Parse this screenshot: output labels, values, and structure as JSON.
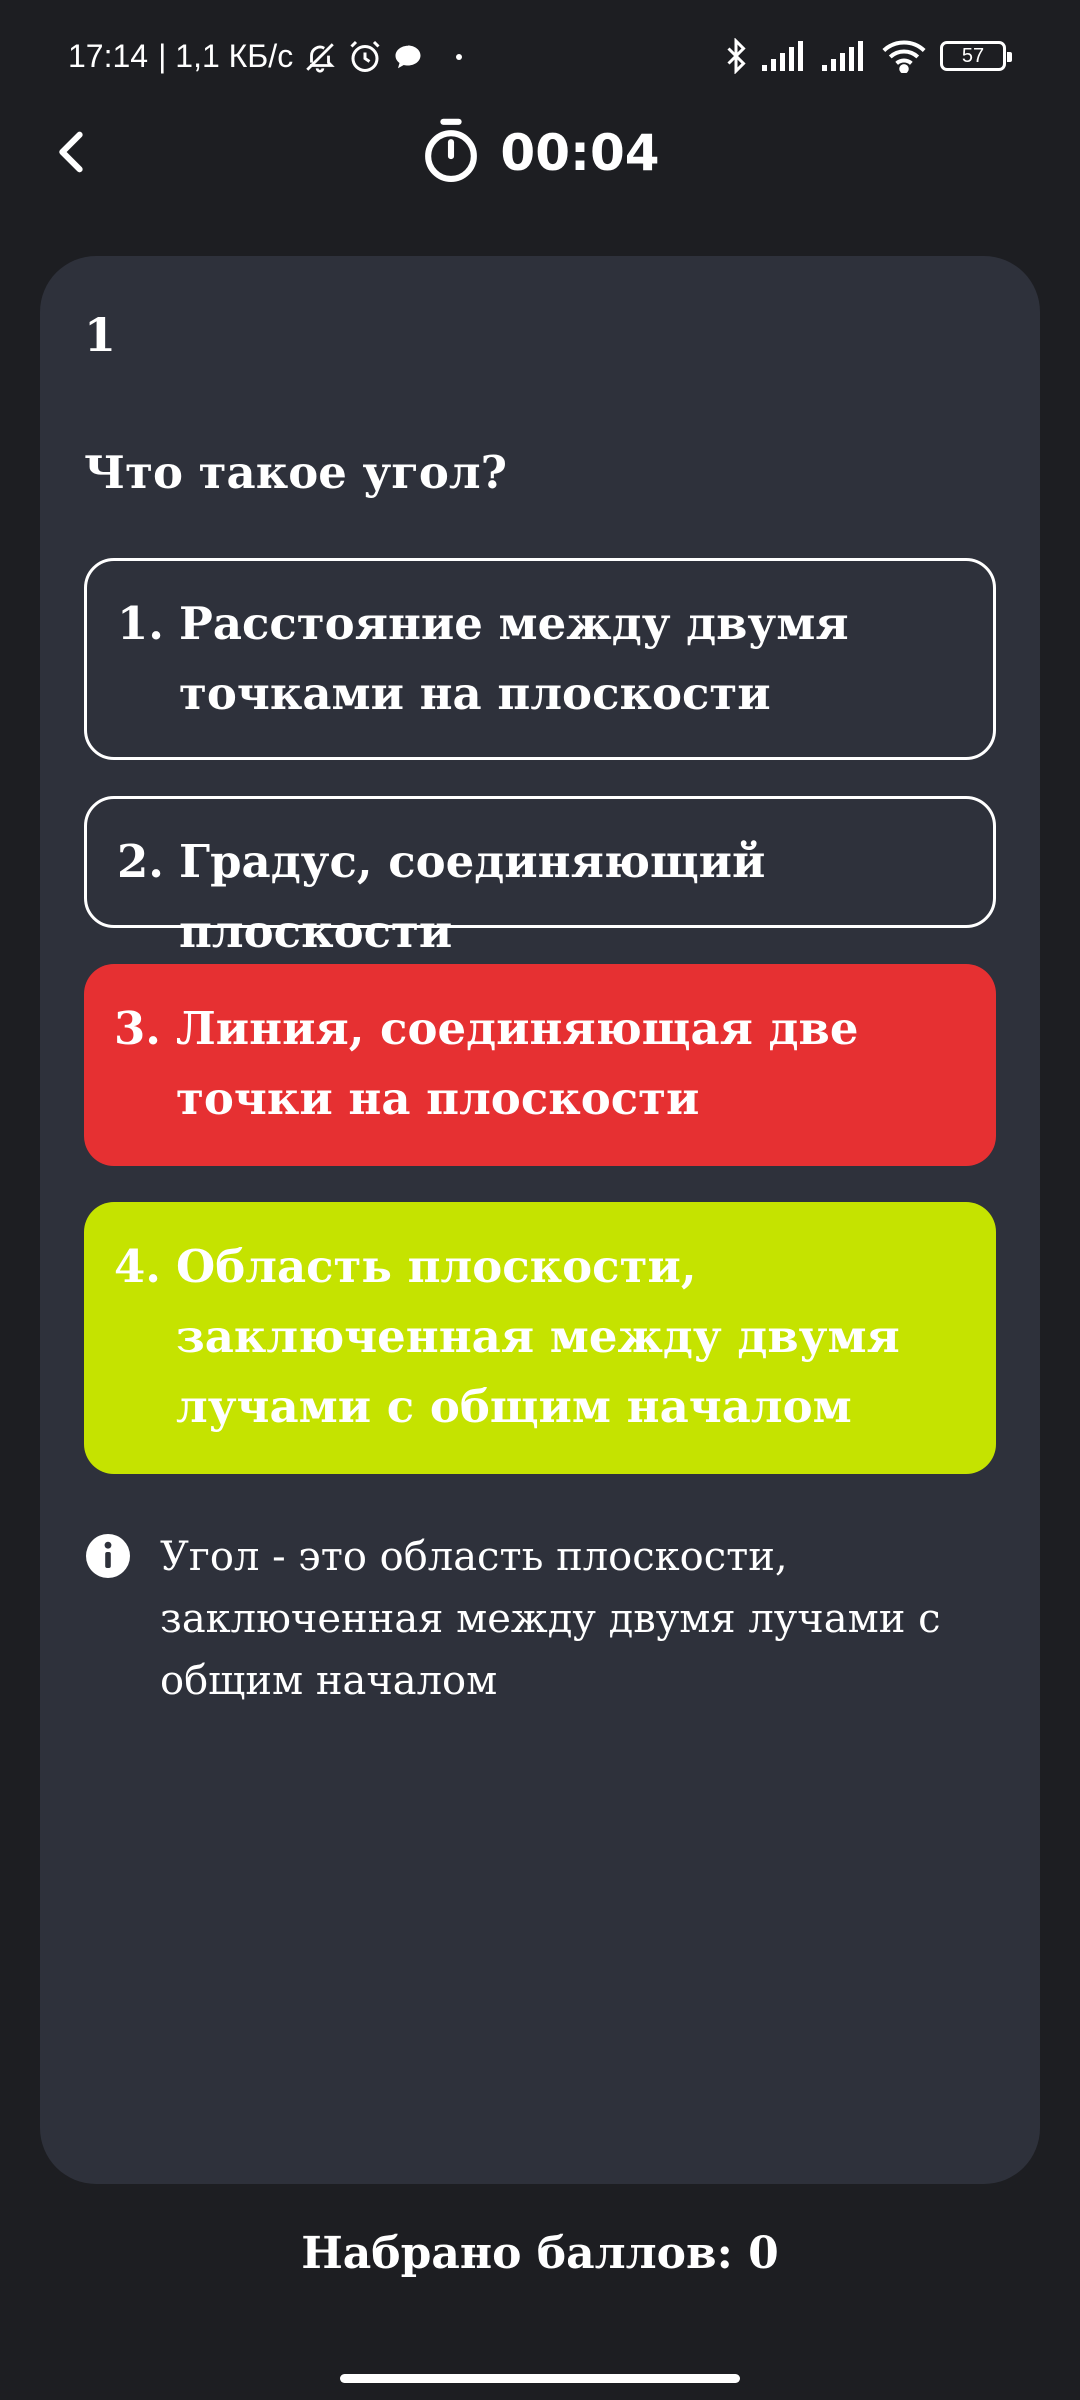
{
  "status_bar": {
    "time": "17:14",
    "speed": "| 1,1 КБ/с",
    "battery": "57",
    "icons": [
      "bell-off-icon",
      "alarm-icon",
      "chat-bubble-icon",
      "dot-icon",
      "bluetooth-icon",
      "signal-icon",
      "signal-icon",
      "wifi-icon",
      "battery-icon"
    ]
  },
  "header": {
    "timer": "00:04",
    "icons": [
      "back-chevron-icon",
      "stopwatch-icon"
    ]
  },
  "question": {
    "number": "1",
    "text": "Что такое угол?"
  },
  "answers": [
    {
      "num": "1.",
      "text": "Расстояние между двумя точками на плоскости",
      "state": "default"
    },
    {
      "num": "2.",
      "text": "Градус, соединяющий плоскости",
      "state": "default"
    },
    {
      "num": "3.",
      "text": "Линия, соединяющая две точки на плоскости",
      "state": "wrong"
    },
    {
      "num": "4.",
      "text": "Область плоскости, заключенная между двумя лучами с общим началом",
      "state": "correct"
    }
  ],
  "explanation": {
    "icon": "info-icon",
    "text": "Угол - это область плоскости, заключенная между двумя лучами с общим началом"
  },
  "score": {
    "text": "Набрано баллов: 0"
  },
  "colors": {
    "background": "#1d1e22",
    "card": "#2e313b",
    "wrong": "#e63032",
    "correct": "#c5e300",
    "text": "#ffffff"
  }
}
